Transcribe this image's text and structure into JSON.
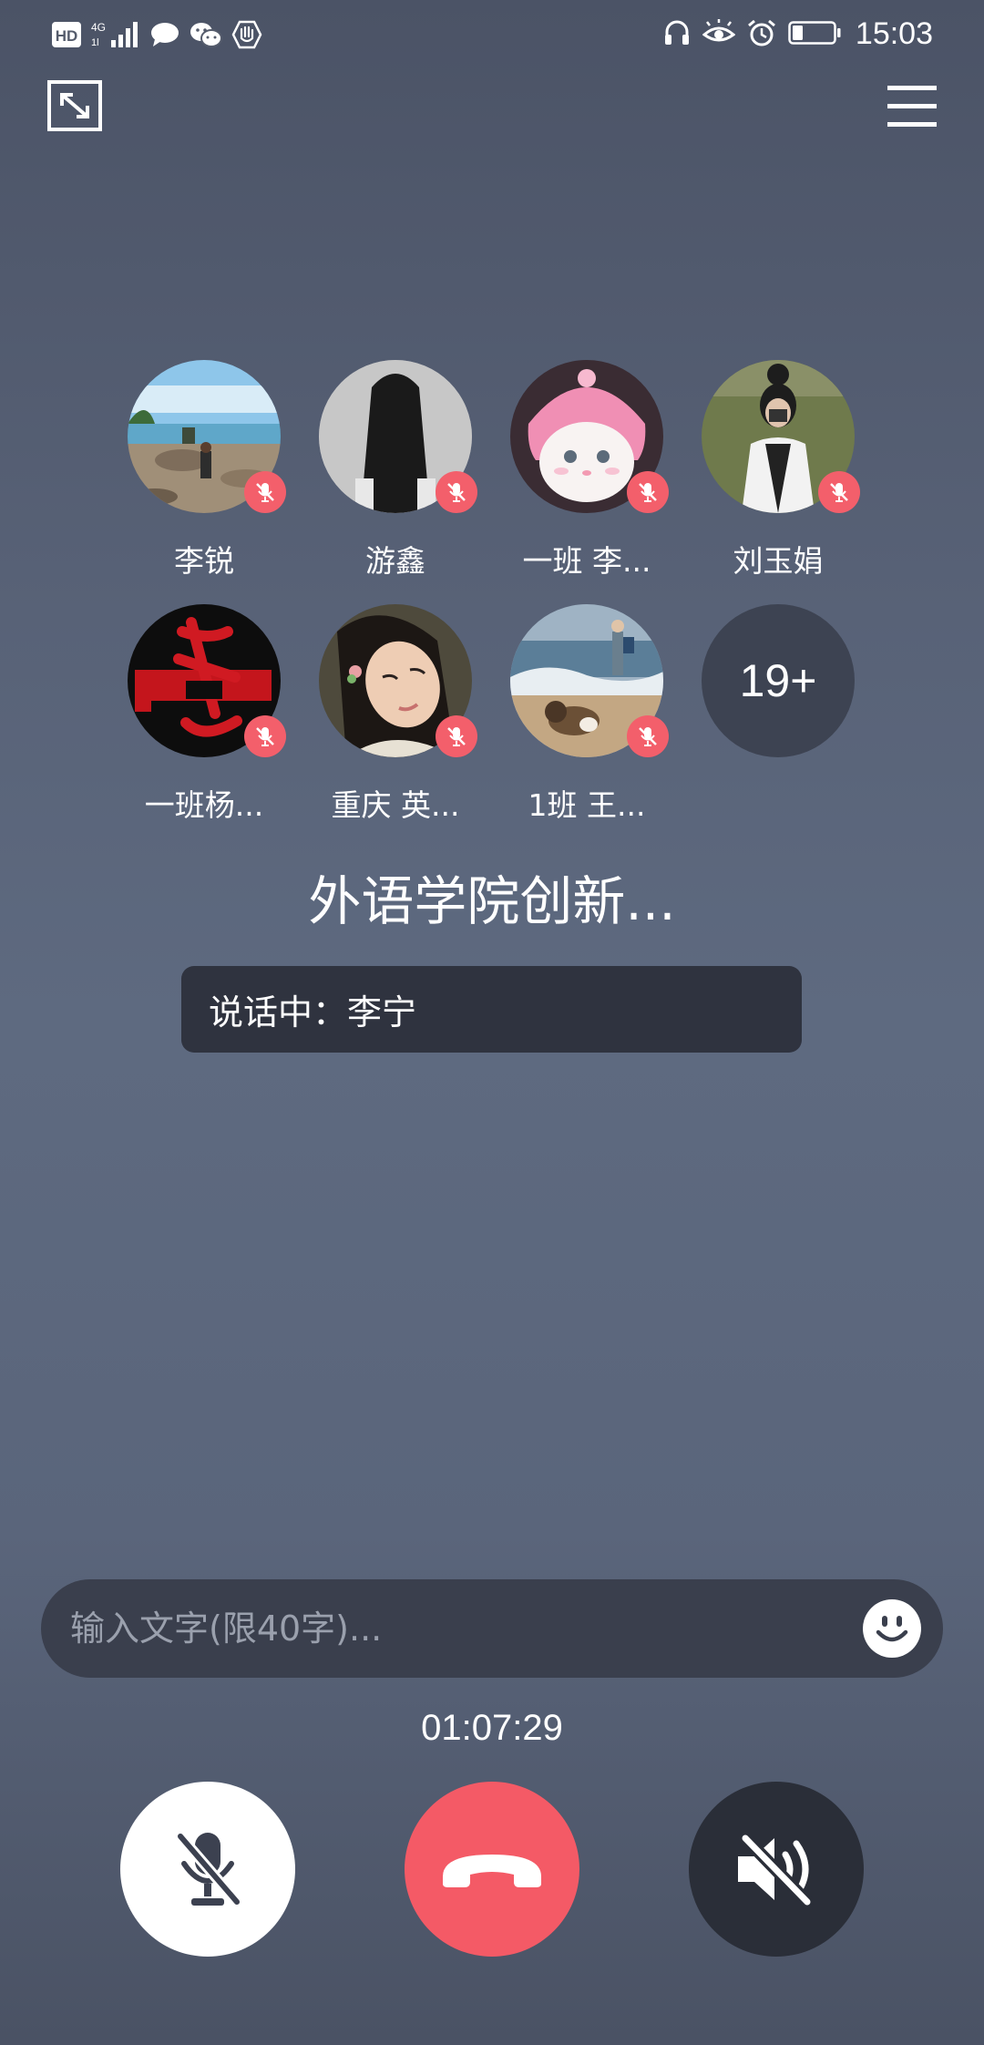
{
  "status_bar": {
    "time": "15:03",
    "left_icons": [
      "hd-icon",
      "signal-4g-icon",
      "message-icon",
      "wechat-icon",
      "hand-icon"
    ],
    "right_icons": [
      "headset-icon",
      "eye-icon",
      "alarm-icon",
      "battery-icon"
    ]
  },
  "members": [
    {
      "name": "李锐",
      "avatar": "beach-rocks-photo",
      "muted": true
    },
    {
      "name": "游鑫",
      "avatar": "long-hair-figure-photo",
      "muted": true
    },
    {
      "name": "一班 李...",
      "avatar": "pink-hat-cat-photo",
      "muted": true
    },
    {
      "name": "刘玉娟",
      "avatar": "girl-on-grass-photo",
      "muted": true
    },
    {
      "name": "一班杨...",
      "avatar": "red-calligraphy-logo",
      "muted": true
    },
    {
      "name": "重庆  英...",
      "avatar": "girl-portrait-photo",
      "muted": true
    },
    {
      "name": "1班  王...",
      "avatar": "beach-dog-photo",
      "muted": true
    }
  ],
  "more_count": "19+",
  "group_title": "外语学院创新...",
  "speaking_text": "说话中：李宁",
  "chat": {
    "placeholder": "输入文字(限40字)..."
  },
  "call_timer": "01:07:29",
  "colors": {
    "mute_badge": "#f35f6b",
    "hangup": "#f45a66",
    "panel_dark": "#2f333f"
  }
}
